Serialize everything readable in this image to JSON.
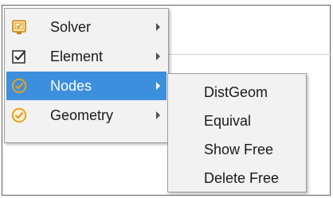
{
  "menu": {
    "items": [
      {
        "label": "Solver",
        "icon": "solver-monitor-icon",
        "selected": false
      },
      {
        "label": "Element",
        "icon": "element-check-icon",
        "selected": false
      },
      {
        "label": "Nodes",
        "icon": "nodes-check-icon",
        "selected": true
      },
      {
        "label": "Geometry",
        "icon": "geometry-check-icon",
        "selected": false
      }
    ]
  },
  "submenu": {
    "items": [
      {
        "label": "DistGeom"
      },
      {
        "label": "Equival"
      },
      {
        "label": "Show Free"
      },
      {
        "label": "Delete Free"
      }
    ]
  },
  "colors": {
    "selected_bg": "#3c8fdc",
    "menu_bg": "#f2f2f2",
    "icon_orange": "#e8a21a"
  }
}
